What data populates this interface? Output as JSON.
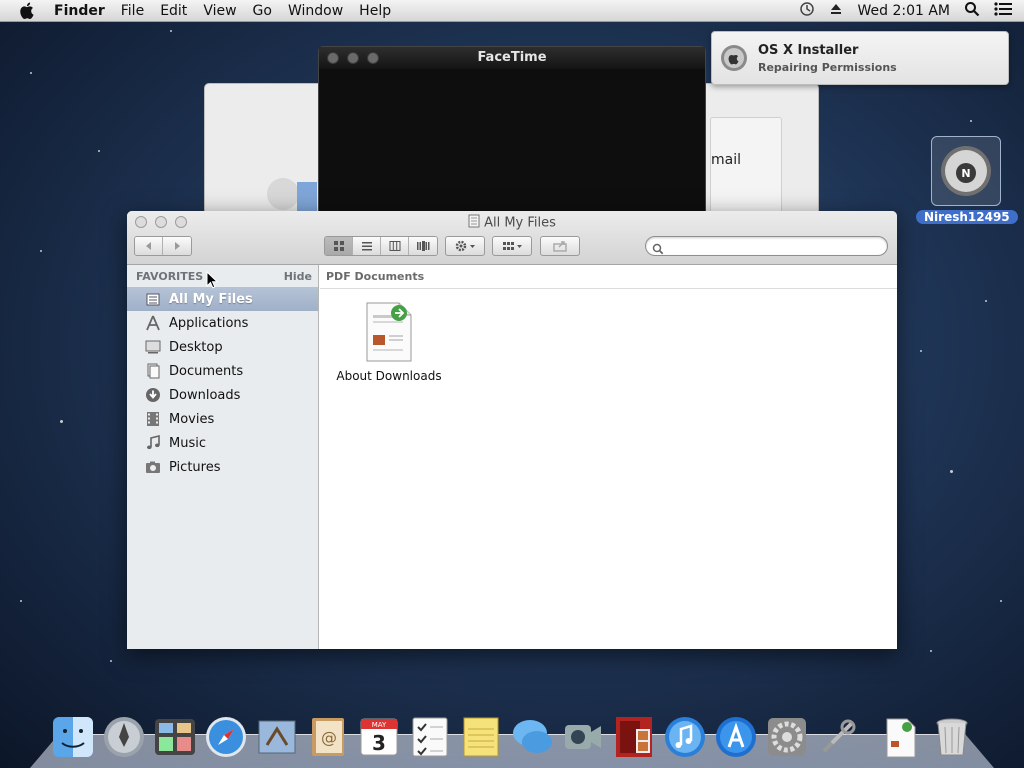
{
  "menubar": {
    "app_name": "Finder",
    "menus": [
      "File",
      "Edit",
      "View",
      "Go",
      "Window",
      "Help"
    ],
    "clock": "Wed 2:01 AM"
  },
  "facetime": {
    "title": "FaceTime"
  },
  "background_window": {
    "fragment_text": "mail"
  },
  "notification": {
    "title": "OS X Installer",
    "subtitle": "Repairing Permissions"
  },
  "desktop_disk": {
    "label": "Niresh12495"
  },
  "finder": {
    "window_title": "All My Files",
    "search": {
      "value": "",
      "placeholder": ""
    },
    "sidebar": {
      "section_title": "FAVORITES",
      "hide_label": "Hide",
      "items": [
        {
          "label": "All My Files",
          "icon": "all-files-icon",
          "selected": true
        },
        {
          "label": "Applications",
          "icon": "applications-icon"
        },
        {
          "label": "Desktop",
          "icon": "desktop-icon"
        },
        {
          "label": "Documents",
          "icon": "documents-icon"
        },
        {
          "label": "Downloads",
          "icon": "downloads-icon"
        },
        {
          "label": "Movies",
          "icon": "movies-icon"
        },
        {
          "label": "Music",
          "icon": "music-icon"
        },
        {
          "label": "Pictures",
          "icon": "pictures-icon"
        }
      ]
    },
    "content": {
      "group_title": "PDF Documents",
      "files": [
        {
          "name": "About Downloads",
          "icon": "pdf-document-icon"
        }
      ]
    }
  },
  "dock": {
    "items": [
      "finder-icon",
      "launchpad-icon",
      "mission-control-icon",
      "safari-icon",
      "mail-icon",
      "contacts-icon",
      "calendar-icon",
      "reminders-icon",
      "notes-icon",
      "messages-icon",
      "facetime-icon",
      "photo-booth-icon",
      "itunes-icon",
      "app-store-icon",
      "system-preferences-icon",
      "utilities-icon",
      "document-icon",
      "trash-icon"
    ],
    "calendar_day": "3",
    "calendar_month": "MAY"
  },
  "colors": {
    "selection": "#9fb0c8",
    "sidebar_bg": "#e9ecef",
    "desktop": "#1f3556",
    "disk_label_bg": "#3f6fc8"
  }
}
